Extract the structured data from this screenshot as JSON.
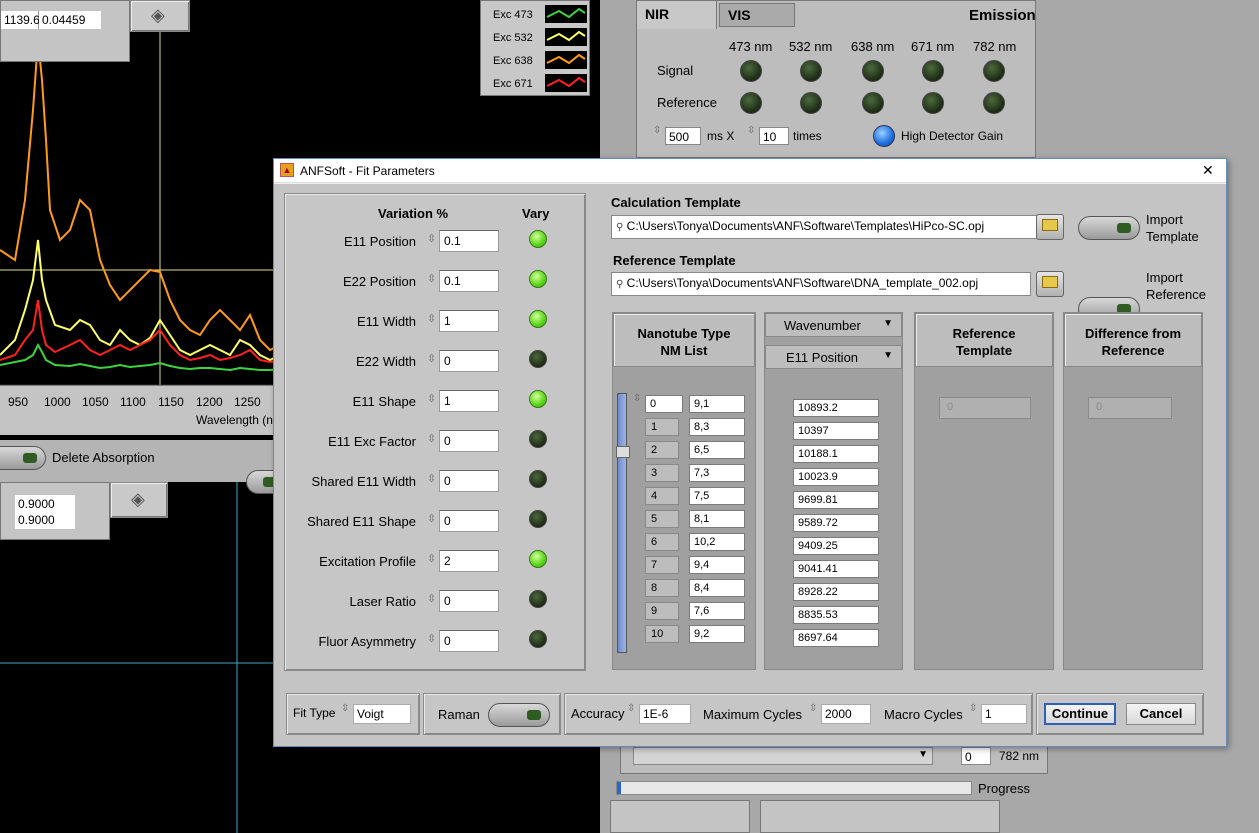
{
  "background": {
    "top_readout": {
      "value1": "1139.6",
      "value2": "0.04459"
    },
    "lower_readout": {
      "value1": "0.9000",
      "value2": "0.9000"
    },
    "legend": [
      {
        "label": "Exc 473",
        "color": "#3fd23f"
      },
      {
        "label": "Exc 532",
        "color": "#ffff66"
      },
      {
        "label": "Exc 638",
        "color": "#ff9a1a"
      },
      {
        "label": "Exc 671",
        "color": "#ff2020"
      }
    ],
    "x_ticks": [
      "950",
      "1000",
      "1050",
      "1100",
      "1150",
      "1200",
      "1250"
    ],
    "x_axis_label": "Wavelength (n",
    "delete_absorption_label": "Delete Absorption",
    "tabs": [
      "NIR",
      "VIS"
    ],
    "emission_label": "Emission",
    "wavelengths": [
      "473 nm",
      "532 nm",
      "638 nm",
      "671 nm",
      "782 nm"
    ],
    "signal_label": "Signal",
    "reference_label": "Reference",
    "exposure_value": "500",
    "exposure_unit": "ms X",
    "times_value": "10",
    "times_label": "times",
    "high_gain_label": "High Detector Gain",
    "bottom_index": "0",
    "bottom_nm": "782 nm",
    "progress_label": "Progress",
    "progress_fraction": 0.0
  },
  "dialog": {
    "title": "ANFSoft - Fit Parameters",
    "close_glyph": "✕",
    "variation_header": "Variation %",
    "vary_header": "Vary",
    "params": [
      {
        "label": "E11 Position",
        "value": "0.1",
        "vary": true
      },
      {
        "label": "E22 Position",
        "value": "0.1",
        "vary": true
      },
      {
        "label": "E11 Width",
        "value": "1",
        "vary": true
      },
      {
        "label": "E22 Width",
        "value": "0",
        "vary": false
      },
      {
        "label": "E11 Shape",
        "value": "1",
        "vary": true
      },
      {
        "label": "E11 Exc Factor",
        "value": "0",
        "vary": false
      },
      {
        "label": "Shared E11 Width",
        "value": "0",
        "vary": false
      },
      {
        "label": "Shared E11 Shape",
        "value": "0",
        "vary": false
      },
      {
        "label": "Excitation Profile",
        "value": "2",
        "vary": true
      },
      {
        "label": "Laser Ratio",
        "value": "0",
        "vary": false
      },
      {
        "label": "Fluor Asymmetry",
        "value": "0",
        "vary": false
      }
    ],
    "calc_template_label": "Calculation Template",
    "calc_template_path": "C:\\Users\\Tonya\\Documents\\ANF\\Software\\Templates\\HiPco-SC.opj",
    "import_template_label": "Import Template",
    "ref_template_label": "Reference Template",
    "ref_template_path": "C:\\Users\\Tonya\\Documents\\ANF\\Software\\DNA_template_002.opj",
    "import_reference_label": "Import Reference",
    "nanotube_header": "Nanotube Type NM List",
    "wavenumber_select": "Wavenumber",
    "e11_position_select": "E11 Position",
    "reference_header": "Reference Template",
    "difference_header": "Difference from Reference",
    "list_start_index": "0",
    "indices": [
      "1",
      "2",
      "3",
      "4",
      "5",
      "6",
      "7",
      "8",
      "9",
      "10"
    ],
    "nm_list": [
      "9,1",
      "8,3",
      "6,5",
      "7,3",
      "7,5",
      "8,1",
      "10,2",
      "9,4",
      "8,4",
      "7,6",
      "9,2"
    ],
    "positions": [
      "10893.2",
      "10397",
      "10188.1",
      "10023.9",
      "9699.81",
      "9589.72",
      "9409.25",
      "9041.41",
      "8928.22",
      "8835.53",
      "8697.64"
    ],
    "ref_value": "0",
    "diff_value": "0",
    "fit_type_label": "Fit Type",
    "fit_type_value": "Voigt",
    "raman_label": "Raman",
    "accuracy_label": "Accuracy",
    "accuracy_value": "1E-6",
    "max_cycles_label": "Maximum Cycles",
    "max_cycles_value": "2000",
    "macro_cycles_label": "Macro Cycles",
    "macro_cycles_value": "1",
    "continue_label": "Continue",
    "cancel_label": "Cancel"
  }
}
